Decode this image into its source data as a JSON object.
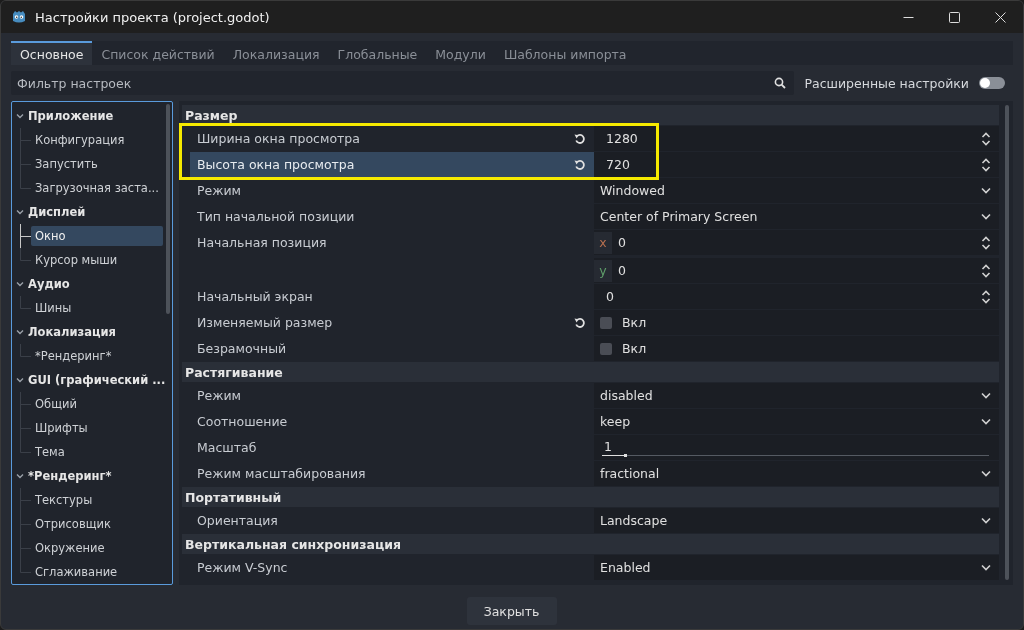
{
  "window": {
    "title": "Настройки проекта (project.godot)"
  },
  "tabs": [
    {
      "label": "Основное",
      "selected": true
    },
    {
      "label": "Список действий",
      "selected": false
    },
    {
      "label": "Локализация",
      "selected": false
    },
    {
      "label": "Глобальные",
      "selected": false
    },
    {
      "label": "Модули",
      "selected": false
    },
    {
      "label": "Шаблоны импорта",
      "selected": false
    }
  ],
  "filter": {
    "placeholder": "Фильтр настроек"
  },
  "advanced_toggle": {
    "label": "Расширенные настройки",
    "on": false
  },
  "sidebar": {
    "items": [
      {
        "label": "Приложение",
        "expanded": true,
        "children": [
          {
            "label": "Конфигурация",
            "selected": false
          },
          {
            "label": "Запустить",
            "selected": false
          },
          {
            "label": "Загрузочная заста...",
            "selected": false
          }
        ]
      },
      {
        "label": "Дисплей",
        "expanded": true,
        "children": [
          {
            "label": "Окно",
            "selected": true
          },
          {
            "label": "Курсор мыши",
            "selected": false
          }
        ]
      },
      {
        "label": "Аудио",
        "expanded": true,
        "children": [
          {
            "label": "Шины",
            "selected": false
          }
        ]
      },
      {
        "label": "Локализация",
        "expanded": true,
        "children": [
          {
            "label": "*Рендеринг*",
            "selected": false
          }
        ]
      },
      {
        "label": "GUI (графический ...",
        "expanded": true,
        "children": [
          {
            "label": "Общий",
            "selected": false
          },
          {
            "label": "Шрифты",
            "selected": false
          },
          {
            "label": "Тема",
            "selected": false
          }
        ]
      },
      {
        "label": "*Рендеринг*",
        "expanded": true,
        "children": [
          {
            "label": "Текстуры",
            "selected": false
          },
          {
            "label": "Отрисовщик",
            "selected": false
          },
          {
            "label": "Окружение",
            "selected": false
          },
          {
            "label": "Сглаживание",
            "selected": false
          }
        ]
      }
    ]
  },
  "sections": [
    {
      "title": "Размер",
      "rows": [
        {
          "label": "Ширина окна просмотра",
          "kind": "spin",
          "value": "1280",
          "revert": true,
          "selected": false,
          "highlighted": true
        },
        {
          "label": "Высота окна просмотра",
          "kind": "spin",
          "value": "720",
          "revert": true,
          "selected": true,
          "highlighted": true
        },
        {
          "label": "Режим",
          "kind": "select",
          "value": "Windowed",
          "revert": false,
          "selected": false,
          "highlighted": false
        },
        {
          "label": "Тип начальной позиции",
          "kind": "select",
          "value": "Center of Primary Screen",
          "revert": false,
          "selected": false,
          "highlighted": false
        },
        {
          "label": "Начальная позиция",
          "kind": "vector",
          "components": [
            {
              "axis": "x",
              "value": "0",
              "color": "#b8704f"
            },
            {
              "axis": "y",
              "value": "0",
              "color": "#5f9e6a"
            }
          ],
          "revert": false,
          "selected": false,
          "highlighted": false
        },
        {
          "label": "Начальный экран",
          "kind": "spin",
          "value": "0",
          "revert": false,
          "selected": false,
          "highlighted": false
        },
        {
          "label": "Изменяемый размер",
          "kind": "check",
          "value": "Вкл",
          "checked": false,
          "revert": true,
          "selected": false,
          "highlighted": false
        },
        {
          "label": "Безрамочный",
          "kind": "check",
          "value": "Вкл",
          "checked": false,
          "revert": false,
          "selected": false,
          "highlighted": false
        }
      ]
    },
    {
      "title": "Растягивание",
      "rows": [
        {
          "label": "Режим",
          "kind": "select",
          "value": "disabled",
          "revert": false,
          "selected": false,
          "highlighted": false
        },
        {
          "label": "Соотношение",
          "kind": "select",
          "value": "keep",
          "revert": false,
          "selected": false,
          "highlighted": false
        },
        {
          "label": "Масштаб",
          "kind": "slider",
          "value": "1",
          "level": 0.06,
          "revert": false,
          "selected": false,
          "highlighted": false
        },
        {
          "label": "Режим масштабирования",
          "kind": "select",
          "value": "fractional",
          "revert": false,
          "selected": false,
          "highlighted": false
        }
      ]
    },
    {
      "title": "Портативный",
      "rows": [
        {
          "label": "Ориентация",
          "kind": "select",
          "value": "Landscape",
          "revert": false,
          "selected": false,
          "highlighted": false
        }
      ]
    },
    {
      "title": "Вертикальная синхронизация",
      "rows": [
        {
          "label": "Режим V-Sync",
          "kind": "select",
          "value": "Enabled",
          "revert": false,
          "selected": false,
          "highlighted": false
        }
      ]
    }
  ],
  "close_button": {
    "label": "Закрыть"
  }
}
